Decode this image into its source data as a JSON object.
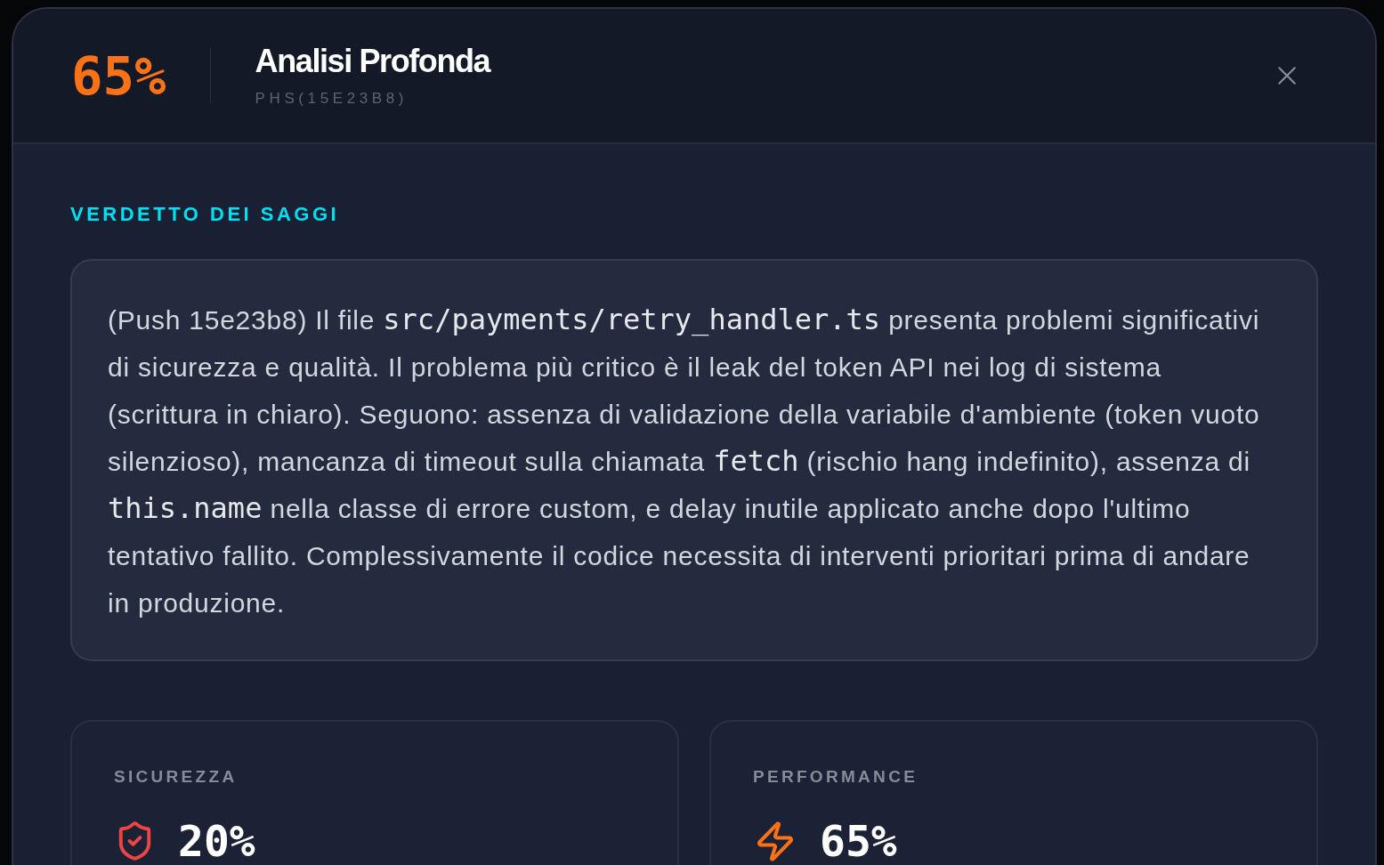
{
  "header": {
    "score": "65%",
    "title": "Analisi Profonda",
    "subtitle": "PHS(15E23B8)"
  },
  "verdict": {
    "heading": "VERDETTO DEI SAGGI",
    "segments": [
      {
        "kind": "text",
        "text": "(Push 15e23b8) Il file "
      },
      {
        "kind": "code",
        "text": "src/payments/retry_handler.ts"
      },
      {
        "kind": "text",
        "text": " presenta problemi significativi di sicurezza e qualità. Il problema più critico è il leak del token API nei log di sistema (scrittura in chiaro). Seguono: assenza di validazione della variabile d'ambiente (token vuoto silenzioso), mancanza di timeout sulla chiamata "
      },
      {
        "kind": "code",
        "text": "fetch"
      },
      {
        "kind": "text",
        "text": " (rischio hang indefinito), assenza di "
      },
      {
        "kind": "code",
        "text": "this.name"
      },
      {
        "kind": "text",
        "text": " nella classe di errore custom, e delay inutile applicato anche dopo l'ultimo tentativo fallito. Complessivamente il codice necessita di interventi prioritari prima di andare in produzione."
      }
    ]
  },
  "metrics": [
    {
      "kind": "security",
      "label": "SICUREZZA",
      "value": "20%"
    },
    {
      "kind": "performance",
      "label": "PERFORMANCE",
      "value": "65%"
    }
  ]
}
